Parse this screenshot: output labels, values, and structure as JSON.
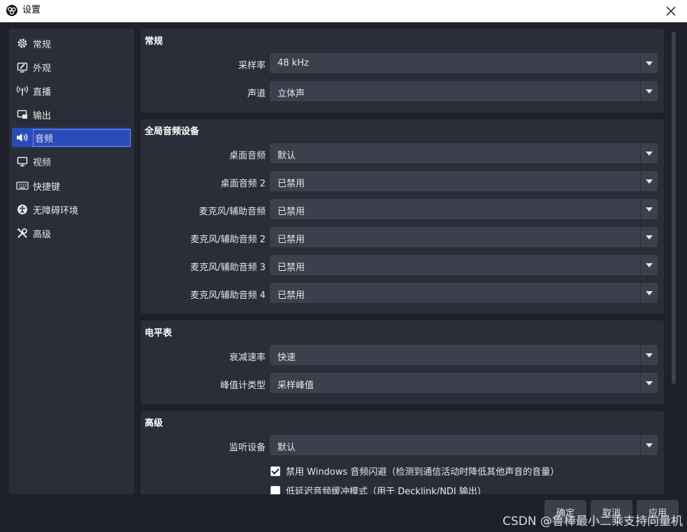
{
  "window": {
    "title": "设置",
    "close_symbol": "×"
  },
  "sidebar": {
    "items": [
      {
        "label": "常规",
        "icon": "gear-icon"
      },
      {
        "label": "外观",
        "icon": "appearance-icon"
      },
      {
        "label": "直播",
        "icon": "broadcast-icon"
      },
      {
        "label": "输出",
        "icon": "output-icon"
      },
      {
        "label": "音频",
        "icon": "speaker-icon",
        "active": true
      },
      {
        "label": "视频",
        "icon": "monitor-icon"
      },
      {
        "label": "快捷键",
        "icon": "keyboard-icon"
      },
      {
        "label": "无障碍环境",
        "icon": "accessibility-icon"
      },
      {
        "label": "高级",
        "icon": "tools-icon"
      }
    ]
  },
  "groups": {
    "general": {
      "title": "常规",
      "rows": [
        {
          "label": "采样率",
          "value": "48 kHz"
        },
        {
          "label": "声道",
          "value": "立体声"
        }
      ]
    },
    "global_devices": {
      "title": "全局音频设备",
      "rows": [
        {
          "label": "桌面音频",
          "value": "默认"
        },
        {
          "label": "桌面音频 2",
          "value": "已禁用"
        },
        {
          "label": "麦克风/辅助音频",
          "value": "已禁用"
        },
        {
          "label": "麦克风/辅助音频 2",
          "value": "已禁用"
        },
        {
          "label": "麦克风/辅助音频 3",
          "value": "已禁用"
        },
        {
          "label": "麦克风/辅助音频 4",
          "value": "已禁用"
        }
      ]
    },
    "meters": {
      "title": "电平表",
      "rows": [
        {
          "label": "衰减速率",
          "value": "快速"
        },
        {
          "label": "峰值计类型",
          "value": "采样峰值"
        }
      ]
    },
    "advanced": {
      "title": "高级",
      "rows": [
        {
          "label": "监听设备",
          "value": "默认"
        }
      ],
      "checkboxes": [
        {
          "label": "禁用 Windows 音频闪避（检测到通信活动时降低其他声音的音量）",
          "checked": true
        },
        {
          "label": "低延迟音频缓冲模式（用于 Decklink/NDI 输出）",
          "checked": false
        }
      ]
    }
  },
  "buttons": {
    "ok": "确定",
    "cancel": "取消",
    "apply": "应用"
  },
  "watermark": "CSDN @鲁棒最小二乘支持向量机",
  "colors": {
    "window_bg": "#1f212a",
    "panel_bg": "#2b2e38",
    "control_bg": "#3c404d",
    "accent": "#284cb8",
    "text": "#e6e6e6"
  }
}
